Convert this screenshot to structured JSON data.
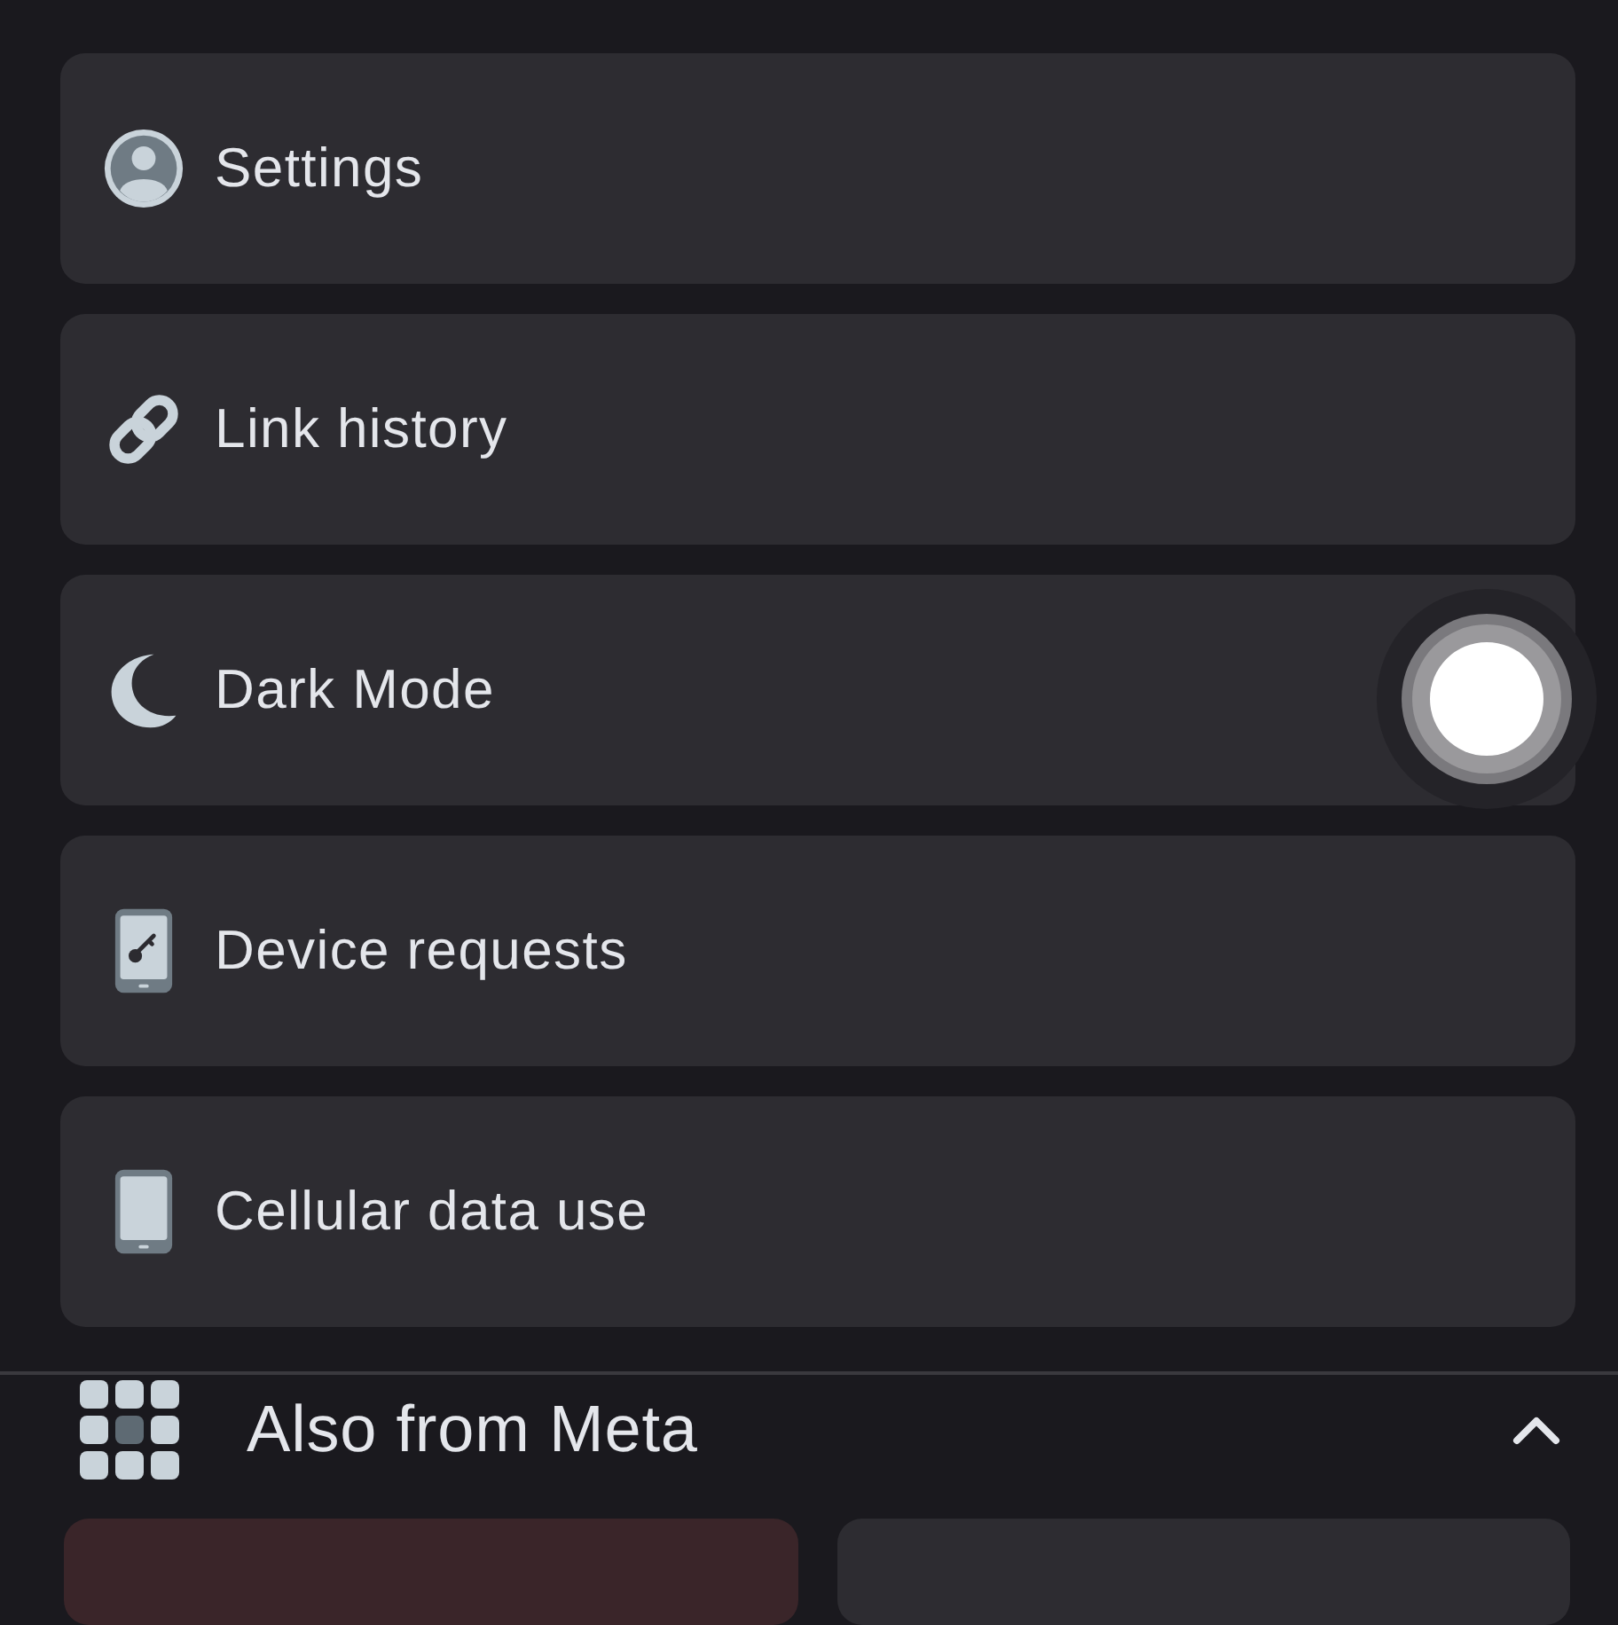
{
  "menu_items": [
    {
      "label": "Settings",
      "touched": false
    },
    {
      "label": "Link history",
      "touched": false
    },
    {
      "label": "Dark Mode",
      "touched": true
    },
    {
      "label": "Device requests",
      "touched": false
    },
    {
      "label": "Cellular data use",
      "touched": false
    }
  ],
  "section": {
    "title": "Also from Meta",
    "expanded": true
  },
  "app_tiles": [
    {
      "color": "#3a2529"
    },
    {
      "color": "#2d2c31"
    }
  ]
}
